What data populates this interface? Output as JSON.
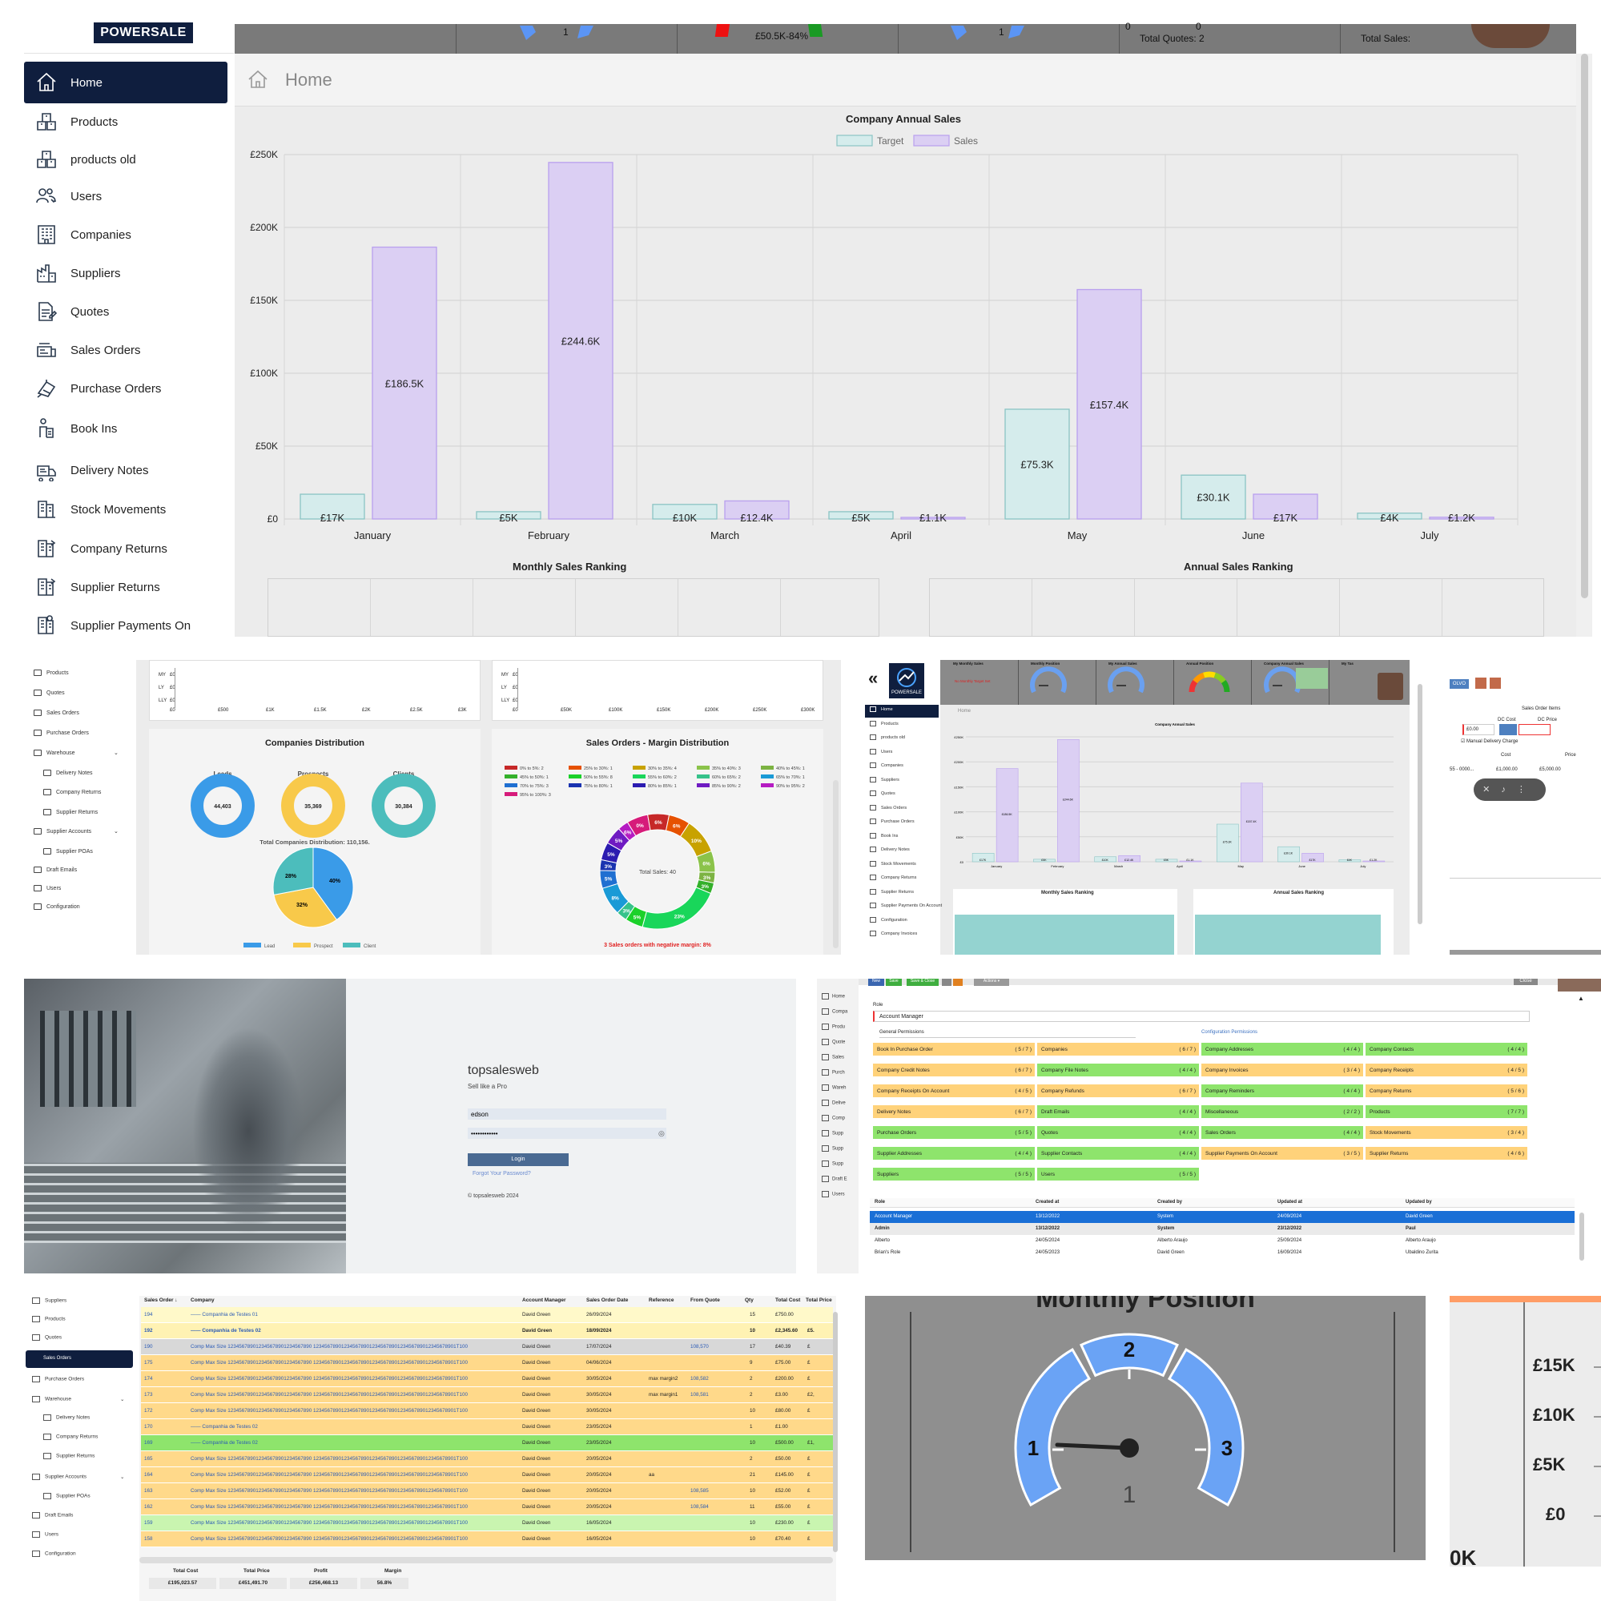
{
  "p1": {
    "logo": "POWERSALE",
    "nav": [
      "Home",
      "Products",
      "products old",
      "Users",
      "Companies",
      "Suppliers",
      "Quotes",
      "Sales Orders",
      "Purchase Orders",
      "Book Ins",
      "Delivery Notes",
      "Stock Movements",
      "Company Returns",
      "Supplier Returns",
      "Supplier Payments On"
    ],
    "nav_icons": [
      "home-icon",
      "box-icon",
      "box-icon",
      "users-icon",
      "building-icon",
      "factory-icon",
      "document-icon",
      "sales-icon",
      "purchase-icon",
      "bookin-icon",
      "delivery-icon",
      "stock-icon",
      "returns-icon",
      "returns-icon",
      "payments-icon"
    ],
    "topbar": {
      "gauge1": "1",
      "gauge2": "1",
      "sales_pct": "£50.5K-84%",
      "zero1": "0",
      "zero2": "0",
      "total_quotes": "Total Quotes: 2",
      "total_sales": "Total Sales:"
    },
    "page_title": "Home",
    "ranking_monthly": "Monthly Sales Ranking",
    "ranking_annual": "Annual Sales Ranking"
  },
  "chart_data": {
    "type": "bar",
    "title": "Company Annual Sales",
    "categories": [
      "January",
      "February",
      "March",
      "April",
      "May",
      "June",
      "July"
    ],
    "series": [
      {
        "name": "Target",
        "values": [
          17,
          5,
          10,
          5,
          75.3,
          30.1,
          4
        ],
        "labels": [
          "£17K",
          "£5K",
          "£10K",
          "£5K",
          "£75.3K",
          "£30.1K",
          "£4K"
        ],
        "color": "#d5ecec"
      },
      {
        "name": "Sales",
        "values": [
          186.5,
          244.6,
          12.4,
          1.1,
          157.4,
          17,
          1.2
        ],
        "labels": [
          "£186.5K",
          "£244.6K",
          "£12.4K",
          "£1.1K",
          "£157.4K",
          "£17K",
          "£1.2K"
        ],
        "color": "#dbcff3"
      }
    ],
    "yticks": [
      "£0",
      "£50K",
      "£100K",
      "£150K",
      "£200K",
      "£250K"
    ],
    "ylim": [
      0,
      250
    ],
    "grid": true,
    "legend": "top-center"
  },
  "p2": {
    "nav": [
      "Products",
      "Quotes",
      "Sales Orders",
      "Purchase Orders",
      "Warehouse",
      "Delivery Notes",
      "Company Returns",
      "Supplier Returns",
      "Supplier Accounts",
      "Supplier POAs",
      "Draft Emails",
      "Users",
      "Configuration"
    ],
    "ax1": [
      "£0",
      "£500",
      "£1K",
      "£1.5K",
      "£2K",
      "£2.5K",
      "£3K"
    ],
    "ax2": [
      "£0",
      "£50K",
      "£100K",
      "£150K",
      "£200K",
      "£250K",
      "£300K"
    ],
    "ylabels": [
      "MY",
      "LY",
      "LLY"
    ],
    "comp_title": "Companies Distribution",
    "donuts": [
      {
        "label": "Leads",
        "value": "44,403"
      },
      {
        "label": "Prospects",
        "value": "35,369"
      },
      {
        "label": "Clients",
        "value": "30,384"
      }
    ],
    "total": "Total Companies Distribution: 110,156.",
    "pie": {
      "lead": "40%",
      "prospect": "32%",
      "client": "28%"
    },
    "pie_legend": [
      "Lead",
      "Prospect",
      "Client"
    ],
    "margin_title": "Sales Orders - Margin Distribution",
    "margin_legend": [
      "0% to 5%: 2",
      "25% to 30%: 1",
      "30% to 35%: 4",
      "35% to 40%: 3",
      "40% to 45%: 1",
      "45% to 50%: 1",
      "50% to 55%: 8",
      "55% to 60%: 2",
      "60% to 65%: 2",
      "65% to 70%: 1",
      "70% to 75%: 3",
      "75% to 80%: 1",
      "80% to 85%: 1",
      "85% to 90%: 2",
      "90% to 95%: 2",
      "95% to 100%: 3"
    ],
    "margin_center": "Total Sales: 40",
    "margin_labels": [
      "0%",
      "6%",
      "6%",
      "10%",
      "6%",
      "3%",
      "3%",
      "23%",
      "5%",
      "3%",
      "8%",
      "5%",
      "3%",
      "5%",
      "5%",
      "6%"
    ],
    "margin_footer": "3 Sales orders with negative margin: 8%"
  },
  "p3": {
    "logo": "POWERSALE",
    "home": "Home",
    "headers": [
      "My Monthly Sales",
      "Monthly Position",
      "My Annual Sales",
      "Annual Position",
      "Company Annual Sales",
      "My Tas"
    ],
    "no_target": "No Monthly Target Set",
    "chart": "Company Annual Sales",
    "rank1": "Monthly Sales Ranking",
    "rank2": "Annual Sales Ranking",
    "nav": [
      "Home",
      "Products",
      "products old",
      "Users",
      "Companies",
      "Suppliers",
      "Quotes",
      "Sales Orders",
      "Purchase Orders",
      "Book Ins",
      "Delivery Notes",
      "Stock Movements",
      "Company Returns",
      "Supplier Returns",
      "Supplier Payments On Account",
      "Configuration",
      "Company Invoices"
    ]
  },
  "p4": {
    "title": "Sales Order Items",
    "dc_cost": "DC Cost",
    "dc_price": "DC Price",
    "v1": "£0.00",
    "chk": "Manual Delivery Charge",
    "cost": "Cost",
    "price": "Price",
    "c1": "£1,000.00",
    "c2": "£5,000.00",
    "row": "55 - 0000..."
  },
  "p5": {
    "app": "topsalesweb",
    "tag": "Sell like a Pro",
    "user": "edson",
    "pwd": "••••••••••••",
    "login": "Login",
    "forgot": "Forgot Your Password?",
    "copy": "© topsalesweb 2024"
  },
  "p6": {
    "buttons": [
      "New",
      "Save",
      "Save & Close"
    ],
    "actions": "Actions ▾",
    "close": "Close",
    "role_label": "Role",
    "role_value": "Account Manager",
    "tab_general": "General Permissions",
    "tab_config": "Configuration Permissions",
    "perms": [
      [
        "Book In Purchase Order",
        "( 5 / 7 )",
        "o"
      ],
      [
        "Companies",
        "( 6 / 7 )",
        "o"
      ],
      [
        "Company Addresses",
        "( 4 / 4 )",
        "g"
      ],
      [
        "Company Contacts",
        "( 4 / 4 )",
        "g"
      ],
      [
        "Company Credit Notes",
        "( 6 / 7 )",
        "o"
      ],
      [
        "Company File Notes",
        "( 4 / 4 )",
        "g"
      ],
      [
        "Company Invoices",
        "( 3 / 4 )",
        "o"
      ],
      [
        "Company Receipts",
        "( 4 / 5 )",
        "o"
      ],
      [
        "Company Receipts On Account",
        "( 4 / 5 )",
        "o"
      ],
      [
        "Company Refunds",
        "( 6 / 7 )",
        "o"
      ],
      [
        "Company Reminders",
        "( 4 / 4 )",
        "g"
      ],
      [
        "Company Returns",
        "( 5 / 6 )",
        "o"
      ],
      [
        "Delivery Notes",
        "( 6 / 7 )",
        "o"
      ],
      [
        "Draft Emails",
        "( 4 / 4 )",
        "g"
      ],
      [
        "Miscellaneous",
        "( 2 / 2 )",
        "g"
      ],
      [
        "Products",
        "( 7 / 7 )",
        "g"
      ],
      [
        "Purchase Orders",
        "( 5 / 5 )",
        "g"
      ],
      [
        "Quotes",
        "( 4 / 4 )",
        "g"
      ],
      [
        "Sales Orders",
        "( 4 / 4 )",
        "g"
      ],
      [
        "Stock Movements",
        "( 3 / 4 )",
        "o"
      ],
      [
        "Supplier Addresses",
        "( 4 / 4 )",
        "g"
      ],
      [
        "Supplier Contacts",
        "( 4 / 4 )",
        "g"
      ],
      [
        "Supplier Payments On Account",
        "( 3 / 5 )",
        "o"
      ],
      [
        "Supplier Returns",
        "( 4 / 6 )",
        "o"
      ],
      [
        "Suppliers",
        "( 5 / 5 )",
        "g"
      ],
      [
        "Users",
        "( 5 / 5 )",
        "g"
      ]
    ],
    "cols": [
      "Role",
      "Created at",
      "Created by",
      "Updated at",
      "Updated by"
    ],
    "rows": [
      [
        "Account Manager",
        "13/12/2022",
        "System",
        "24/09/2024",
        "David Green"
      ],
      [
        "Admin",
        "13/12/2022",
        "System",
        "23/12/2022",
        "Paul"
      ],
      [
        "Alberto",
        "24/05/2024",
        "Alberto Araujo",
        "25/09/2024",
        "Alberto Araujo"
      ],
      [
        "Brian's Role",
        "24/05/2023",
        "David Green",
        "16/09/2024",
        "Ubaldino Zurita"
      ]
    ],
    "nav": [
      "Home",
      "Compa",
      "Produ",
      "Quote",
      "Sales",
      "Purch",
      "Wareh",
      "Delive",
      "Comp",
      "Supp",
      "Supp",
      "Supp",
      "Draft E",
      "Users"
    ]
  },
  "p7": {
    "nav": [
      "Suppliers",
      "Products",
      "Quotes",
      "Sales Orders",
      "Purchase Orders",
      "Warehouse",
      "Delivery Notes",
      "Company Returns",
      "Supplier Returns",
      "Supplier Accounts",
      "Supplier POAs",
      "Draft Emails",
      "Users",
      "Configuration"
    ],
    "cols": [
      "Sales Order ↓",
      "Company",
      "Account Manager",
      "Sales Order Date",
      "Reference",
      "From Quote",
      "Qty",
      "Total Cost",
      "Total Price"
    ],
    "rows": [
      [
        "194",
        "—— Companhia de Testes 01",
        "David Green",
        "26/09/2024",
        "",
        "",
        "15",
        "£750.00",
        "",
        "y"
      ],
      [
        "192",
        "—— Companhia de Testes 02",
        "David Green",
        "18/09/2024",
        "",
        "",
        "10",
        "£2,345.60",
        "£5.",
        "yb"
      ],
      [
        "190",
        "Comp Max Size 123456789012345678901234567890 123456789012345678901234567890123456789012345678901T100",
        "David Green",
        "17/07/2024",
        "",
        "108,570",
        "17",
        "£40.39",
        "£",
        "g"
      ],
      [
        "175",
        "Comp Max Size 123456789012345678901234567890 123456789012345678901234567890123456789012345678901T100",
        "David Green",
        "04/06/2024",
        "",
        "",
        "9",
        "£75.00",
        "£",
        "o"
      ],
      [
        "174",
        "Comp Max Size 123456789012345678901234567890 123456789012345678901234567890123456789012345678901T100",
        "David Green",
        "30/05/2024",
        "max margin2",
        "108,582",
        "2",
        "£200.00",
        "£",
        "o"
      ],
      [
        "173",
        "Comp Max Size 123456789012345678901234567890 123456789012345678901234567890123456789012345678901T100",
        "David Green",
        "30/05/2024",
        "max margin1",
        "108,581",
        "2",
        "£3.00",
        "£2,",
        "o"
      ],
      [
        "172",
        "Comp Max Size 123456789012345678901234567890 123456789012345678901234567890123456789012345678901T100",
        "David Green",
        "30/05/2024",
        "",
        "",
        "10",
        "£80.00",
        "£",
        "o"
      ],
      [
        "170",
        "—— Companhia de Testes 02",
        "David Green",
        "23/05/2024",
        "",
        "",
        "1",
        "£1.00",
        "",
        "o"
      ],
      [
        "169",
        "—— Companhia de Testes 02",
        "David Green",
        "23/05/2024",
        "",
        "",
        "10",
        "£500.00",
        "£1,",
        "gr"
      ],
      [
        "165",
        "Comp Max Size 123456789012345678901234567890 123456789012345678901234567890123456789012345678901T100",
        "David Green",
        "20/05/2024",
        "",
        "",
        "2",
        "£50.00",
        "£",
        "o"
      ],
      [
        "164",
        "Comp Max Size 123456789012345678901234567890 123456789012345678901234567890123456789012345678901T100",
        "David Green",
        "20/05/2024",
        "aa",
        "",
        "21",
        "£145.00",
        "£",
        "o"
      ],
      [
        "163",
        "Comp Max Size 123456789012345678901234567890 123456789012345678901234567890123456789012345678901T100",
        "David Green",
        "20/05/2024",
        "",
        "108,585",
        "10",
        "£52.00",
        "£",
        "o"
      ],
      [
        "162",
        "Comp Max Size 123456789012345678901234567890 123456789012345678901234567890123456789012345678901T100",
        "David Green",
        "20/05/2024",
        "",
        "108,584",
        "11",
        "£55.00",
        "£",
        "o"
      ],
      [
        "159",
        "Comp Max Size 123456789012345678901234567890 123456789012345678901234567890123456789012345678901T100",
        "David Green",
        "16/05/2024",
        "",
        "",
        "10",
        "£230.00",
        "£",
        "lg"
      ],
      [
        "158",
        "Comp Max Size 123456789012345678901234567890 123456789012345678901234567890123456789012345678901T100",
        "David Green",
        "16/05/2024",
        "",
        "",
        "10",
        "£70.40",
        "£",
        "o"
      ]
    ],
    "totals": [
      [
        "Total Cost",
        "£195,023.57"
      ],
      [
        "Total Price",
        "£451,491.70"
      ],
      [
        "Profit",
        "£256,468.13"
      ],
      [
        "Margin",
        "56.8%"
      ]
    ]
  },
  "p8": {
    "title": "Monthly Position",
    "n1": "1",
    "n2": "2",
    "n3": "3",
    "value": "1"
  },
  "p9": {
    "ticks": [
      "£15K",
      "£10K",
      "£5K",
      "£0"
    ],
    "bottom": "0K"
  }
}
